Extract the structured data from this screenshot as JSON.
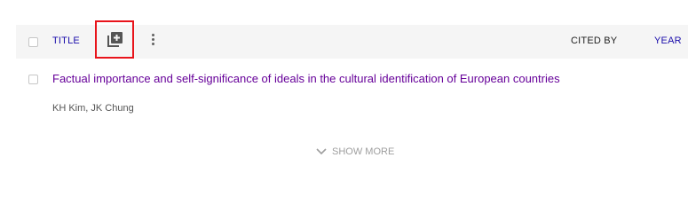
{
  "header": {
    "title_label": "TITLE",
    "cited_by_label": "CITED BY",
    "year_label": "YEAR"
  },
  "icons": {
    "add_column": "add-box-icon",
    "more": "more-vertical-icon",
    "show_more": "chevron-down-icon"
  },
  "colors": {
    "link": "#1a0dab",
    "visited_link": "#660099",
    "highlight": "#e8141b"
  },
  "articles": [
    {
      "title": "Factual importance and self-significance of ideals in the cultural identification of European countries",
      "authors": "KH Kim, JK Chung"
    }
  ],
  "footer": {
    "show_more_label": "SHOW MORE"
  }
}
